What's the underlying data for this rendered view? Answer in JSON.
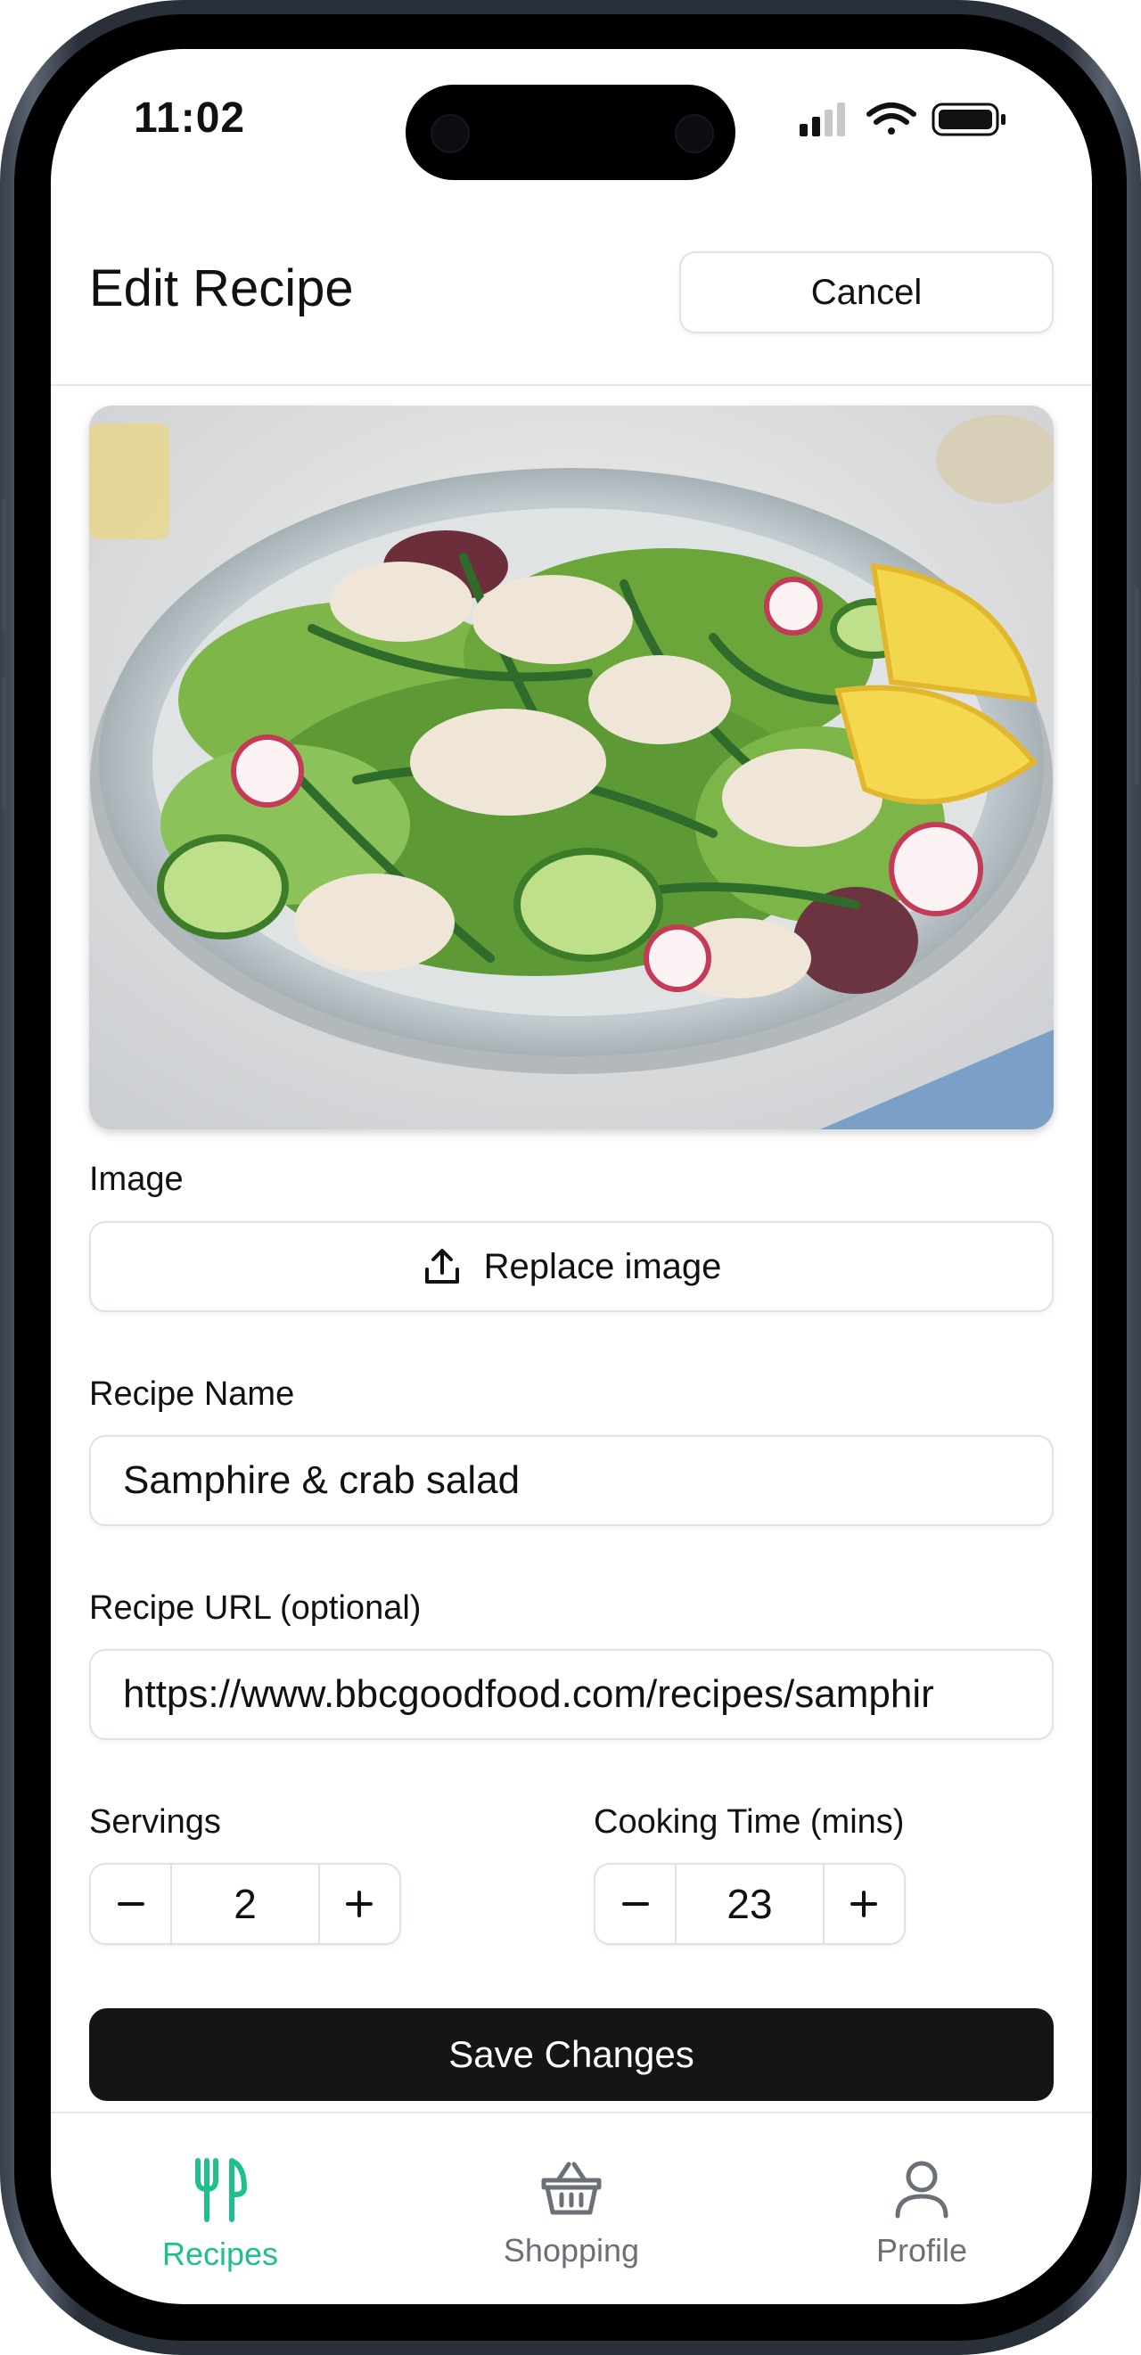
{
  "status_bar": {
    "time": "11:02"
  },
  "header": {
    "title": "Edit Recipe",
    "cancel_label": "Cancel"
  },
  "image_section": {
    "label": "Image",
    "replace_label": "Replace image"
  },
  "form": {
    "name_label": "Recipe Name",
    "name_value": "Samphire & crab salad",
    "url_label": "Recipe URL (optional)",
    "url_value": "https://www.bbcgoodfood.com/recipes/samphir",
    "servings_label": "Servings",
    "servings_value": "2",
    "cooking_label": "Cooking Time (mins)",
    "cooking_value": "23",
    "save_label": "Save Changes"
  },
  "tabs": [
    {
      "label": "Recipes",
      "icon": "fork-knife-icon",
      "active": true
    },
    {
      "label": "Shopping",
      "icon": "basket-icon",
      "active": false
    },
    {
      "label": "Profile",
      "icon": "person-icon",
      "active": false
    }
  ],
  "colors": {
    "accent": "#1fbf8f",
    "inactive": "#6b6f76",
    "primary_button": "#151515"
  }
}
